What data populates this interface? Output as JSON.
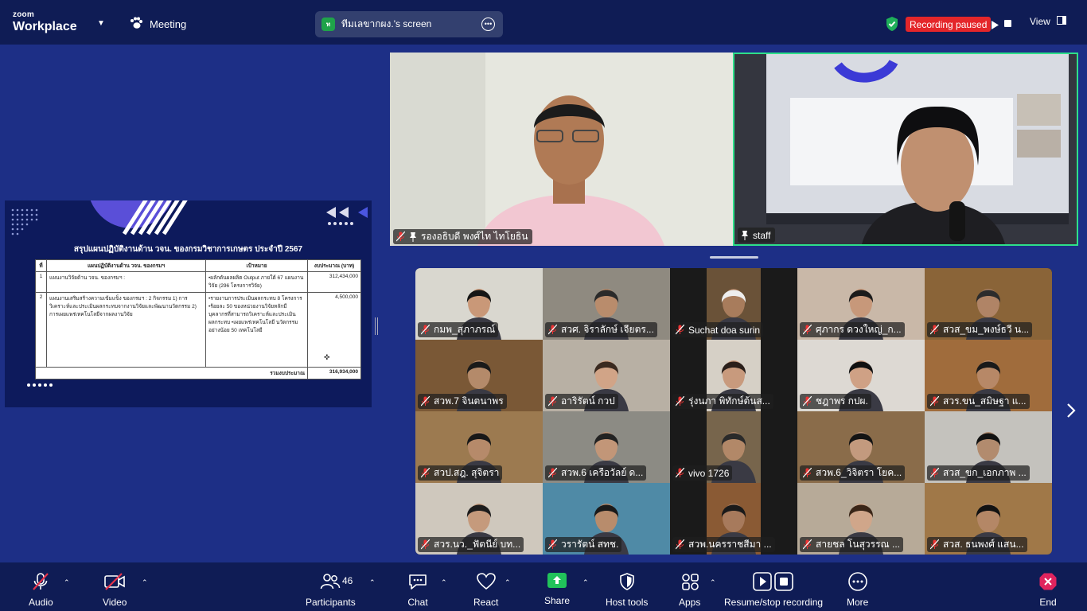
{
  "topbar": {
    "brand_small": "zoom",
    "brand_big": "Workplace",
    "meeting_label": "Meeting",
    "share_avatar_letter": "ท",
    "share_label": "ทีมเลขากผง.'s screen",
    "recording_status": "Recording paused",
    "view_label": "View"
  },
  "slide": {
    "title": "สรุปแผนปฏิบัติงานด้าน วจน. ของกรมวิชาการเกษตร ประจำปี 2567",
    "headers": [
      "ที่",
      "แผนปฏิบัติงานด้าน วจน. ของกรมฯ",
      "เป้าหมาย",
      "งบประมาณ (บาท)"
    ],
    "rows": [
      {
        "no": "1",
        "plan": "แผนงานวิจัยด้าน วจน. ของกรมฯ :",
        "target": "•ผลักดันผลผลิต Output ภายใต้ 67 แผนงานวิจัย (296 โครงการวิจัย)",
        "budget": "312,434,000"
      },
      {
        "no": "2",
        "plan": "แผนงานเสริมสร้างความเข้มแข็ง ของกรมฯ : 2 กิจกรรม 1) การวิเคราะห์และประเมินผลกระทบจากงานวิจัยและพัฒนานวัตกรรม 2) การเผยแพร่เทคโนโลยีจากผลงานวิจัย",
        "target": "•รายงานการประเมินผลกระทบ 8 โครงการ •ร้อยละ 50 ของหน่วยงานวิจัยหลักมีบุคลากรที่สามารถวิเคราะห์และประเมินผลกระทบ •เผยแพร่เทคโนโลยี นวัตกรรม อย่างน้อย 50 เทคโนโลยี",
        "budget": "4,500,000"
      }
    ],
    "total_label": "รวมงบประมาณ",
    "total_value": "316,934,000"
  },
  "speakers": [
    {
      "name": "รองอธิบดี พงศ์ไท ไทโยธิน"
    },
    {
      "name": "staff"
    }
  ],
  "gallery": [
    {
      "name": "กมพ_สุภาภรณ์",
      "bg": "#d9d7cf",
      "skin": "#c99878",
      "hair": "#151515"
    },
    {
      "name": "สวศ. จิราลักษ์ เจียตร...",
      "bg": "#8f8a80",
      "skin": "#b98c6c",
      "hair": "#2a2a2a"
    },
    {
      "name": "Suchat doa surin",
      "bg": "#6a5238",
      "skin": "#a87c5c",
      "hair": "#eeeeee"
    },
    {
      "name": "ศุภากร ดวงใหญ่_ก...",
      "bg": "#c9b8a8",
      "skin": "#c7987a",
      "hair": "#1b1b1b"
    },
    {
      "name": "สวส_ขม_พงษ์ธวี น...",
      "bg": "#8a6438",
      "skin": "#b08466",
      "hair": "#2c2c2c"
    },
    {
      "name": "สวพ.7 จินตนาพร",
      "bg": "#7a5836",
      "skin": "#b48a6a",
      "hair": "#1a1a1a"
    },
    {
      "name": "อาริรัตน์ กวป",
      "bg": "#b8b0a4",
      "skin": "#d1a487",
      "hair": "#3a2a20"
    },
    {
      "name": "รุ่งนภา พิทักษ์ต้นส...",
      "bg": "#d6d0c6",
      "skin": "#c89a7d",
      "hair": "#2a1f1a"
    },
    {
      "name": "ชฎาพร กปผ.",
      "bg": "#ddd9d3",
      "skin": "#cfa185",
      "hair": "#101010"
    },
    {
      "name": "สวร.ขน_สมิษฐา แ...",
      "bg": "#a06c3c",
      "skin": "#b78867",
      "hair": "#1a1a1a"
    },
    {
      "name": "สวป.สฎ. สุจิตรา",
      "bg": "#9c7a50",
      "skin": "#b68a6a",
      "hair": "#181818"
    },
    {
      "name": "สวพ.6 เครือวัลย์ ด...",
      "bg": "#8c8b84",
      "skin": "#c29678",
      "hair": "#222222"
    },
    {
      "name": "vivo 1726",
      "bg": "#77654c",
      "skin": "#b28868",
      "hair": "#2a2a2a"
    },
    {
      "name": "สวพ.6_วิจิตรา โยค...",
      "bg": "#8a6c4a",
      "skin": "#c39a7e",
      "hair": "#141414"
    },
    {
      "name": "สวส_ขก_เอกภาพ ...",
      "bg": "#c4c2bd",
      "skin": "#b28b6e",
      "hair": "#121212"
    },
    {
      "name": "สวร.นว._ฟัตนีย์ บท...",
      "bg": "#cfc8bd",
      "skin": "#c59a7c",
      "hair": "#1c1c1c"
    },
    {
      "name": "วรารัตน์ สทช.",
      "bg": "#4f8aa6",
      "skin": "#b88c6c",
      "hair": "#1a1a1a"
    },
    {
      "name": "สวพ.นครราชสีมา ...",
      "bg": "#8a5a34",
      "skin": "#a77a5c",
      "hair": "#1a1a1a"
    },
    {
      "name": "สายชล โนสุวรรณ ...",
      "bg": "#b7aa98",
      "skin": "#d0a68a",
      "hair": "#3a2618"
    },
    {
      "name": "สวส. ธนพงศ์ แสน...",
      "bg": "#a07848",
      "skin": "#b48766",
      "hair": "#121212"
    }
  ],
  "toolbar": {
    "audio": "Audio",
    "video": "Video",
    "participants": "Participants",
    "participant_count": "46",
    "chat": "Chat",
    "react": "React",
    "share": "Share",
    "host_tools": "Host tools",
    "apps": "Apps",
    "record": "Resume/stop recording",
    "more": "More",
    "end": "End"
  },
  "colors": {
    "background": "#1d2f86",
    "bar": "#0f1c55",
    "recording": "#e4262a",
    "active_speaker": "#2ee08a",
    "share_green": "#1fa34a",
    "end_red": "#e0245e"
  }
}
